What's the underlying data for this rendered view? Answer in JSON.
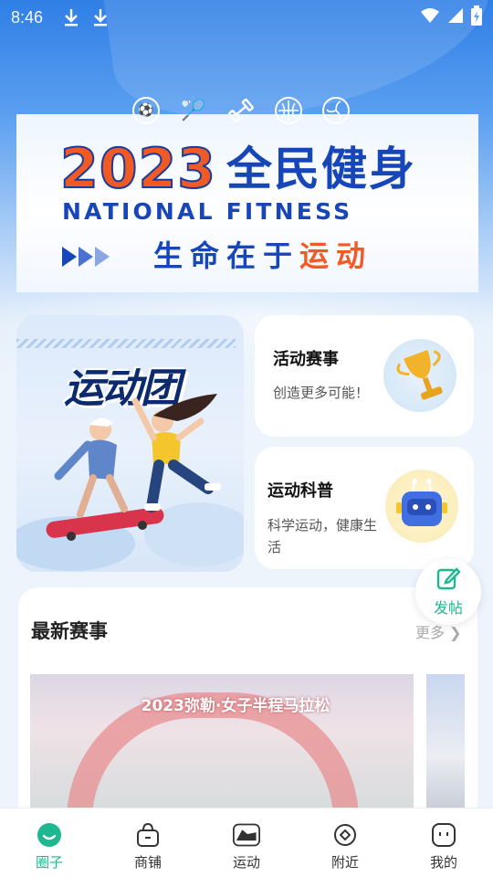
{
  "status_bar": {
    "time": "8:46",
    "icons": [
      "download-icon",
      "download-icon",
      "wifi-icon",
      "cellular-signal-icon",
      "battery-charging-icon"
    ]
  },
  "banner": {
    "year": "2023",
    "title": "全民健身",
    "subtitle_en": "NATIONAL FITNESS",
    "slogan_part1": "生命在于",
    "slogan_part2": "运动",
    "sport_icons": [
      "soccer-ball-icon",
      "badminton-icon",
      "dumbbell-icon",
      "basketball-icon",
      "volleyball-icon"
    ]
  },
  "cards": {
    "big": {
      "title": "运动团"
    },
    "events": {
      "title": "活动赛事",
      "subtitle": "创造更多可能！"
    },
    "science": {
      "title": "运动科普",
      "subtitle": "科学运动，健康生活"
    }
  },
  "fab": {
    "label": "发帖"
  },
  "latest": {
    "title": "最新赛事",
    "more": "更多",
    "image_caption": "2023弥勒·女子半程马拉松"
  },
  "bottom_nav": {
    "items": [
      {
        "label": "圈子",
        "icon": "circle-chat-icon",
        "active": true
      },
      {
        "label": "商铺",
        "icon": "shopping-bag-icon",
        "active": false
      },
      {
        "label": "运动",
        "icon": "sneaker-icon",
        "active": false
      },
      {
        "label": "附近",
        "icon": "location-target-icon",
        "active": false
      },
      {
        "label": "我的",
        "icon": "profile-face-icon",
        "active": false
      }
    ]
  },
  "colors": {
    "accent": "#1db890",
    "banner_blue": "#1746b8",
    "banner_orange": "#f05a24",
    "header_blue": "#2f7fe6"
  }
}
